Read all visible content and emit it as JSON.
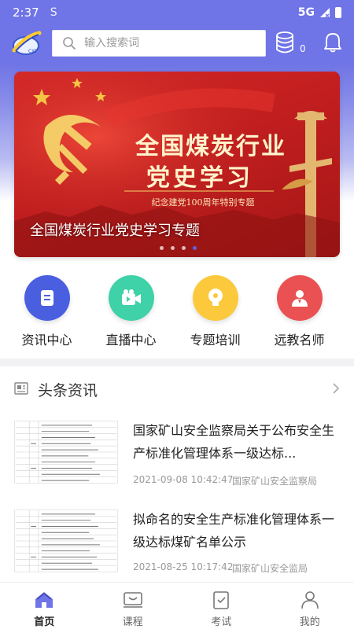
{
  "status_bar": {
    "time": "2:37",
    "sync_glyph": "S",
    "network": "5G"
  },
  "header": {
    "search_placeholder": "输入搜索词",
    "db_count": "0"
  },
  "banner": {
    "title_line1": "全国煤炭行业",
    "title_line2": "党史学习",
    "subtitle": "纪念建党100周年特别专题",
    "caption": "全国煤炭行业党史学习专题",
    "slide_count": 4,
    "active_slide": 4
  },
  "quick_nav": [
    {
      "label": "资讯中心",
      "icon": "news-icon",
      "color": "#4a5fe0"
    },
    {
      "label": "直播中心",
      "icon": "video-camera-icon",
      "color": "#3fd1a8"
    },
    {
      "label": "专题培训",
      "icon": "lightbulb-icon",
      "color": "#fbc93b"
    },
    {
      "label": "远教名师",
      "icon": "teacher-icon",
      "color": "#ea5152"
    }
  ],
  "news": {
    "section_title": "头条资讯",
    "items": [
      {
        "headline": "国家矿山安全监察局关于公布安全生产标准化管理体系一级达标...",
        "date": "2021-09-08 10:42:47",
        "source": "国家矿山安全监察局"
      },
      {
        "headline": "拟命名的安全生产标准化管理体系一级达标煤矿名单公示",
        "date": "2021-08-25 10:17:42",
        "source": "国家矿山安全监局"
      }
    ]
  },
  "bottom_nav": [
    {
      "label": "首页",
      "icon": "home-icon",
      "active": true
    },
    {
      "label": "课程",
      "icon": "course-icon",
      "active": false
    },
    {
      "label": "考试",
      "icon": "exam-icon",
      "active": false
    },
    {
      "label": "我的",
      "icon": "profile-icon",
      "active": false
    }
  ]
}
